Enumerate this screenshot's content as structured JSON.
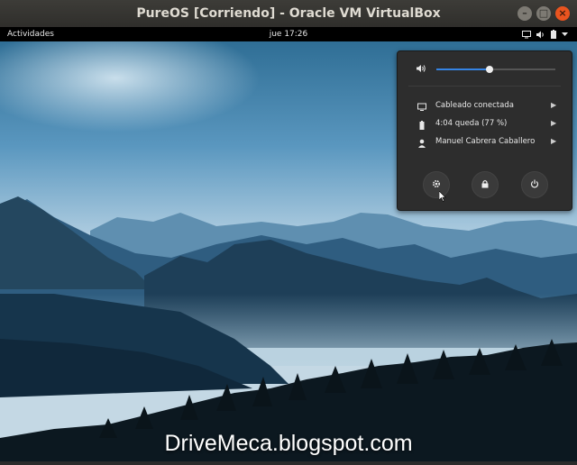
{
  "window": {
    "title": "PureOS [Corriendo] - Oracle VM VirtualBox",
    "buttons": [
      "minimize",
      "maximize",
      "close"
    ]
  },
  "topbar": {
    "activities": "Actividades",
    "clock": "jue 17:26",
    "tray_icons": [
      "display-icon",
      "volume-icon",
      "battery-icon",
      "chevron-down-icon"
    ]
  },
  "menu": {
    "volume_level": 0.45,
    "items": [
      {
        "icon": "display-icon",
        "label": "Cableado conectada"
      },
      {
        "icon": "battery-icon",
        "label": "4:04 queda (77 %)"
      },
      {
        "icon": "user-icon",
        "label": "Manuel Cabrera Caballero"
      }
    ],
    "buttons": [
      "settings-icon",
      "lock-icon",
      "power-icon"
    ]
  },
  "watermark": "DriveMeca.blogspot.com",
  "colors": {
    "accent": "#3584e4",
    "menu_bg": "#2d2d2d",
    "close_button": "#e9541f",
    "topbar": "#000000"
  }
}
